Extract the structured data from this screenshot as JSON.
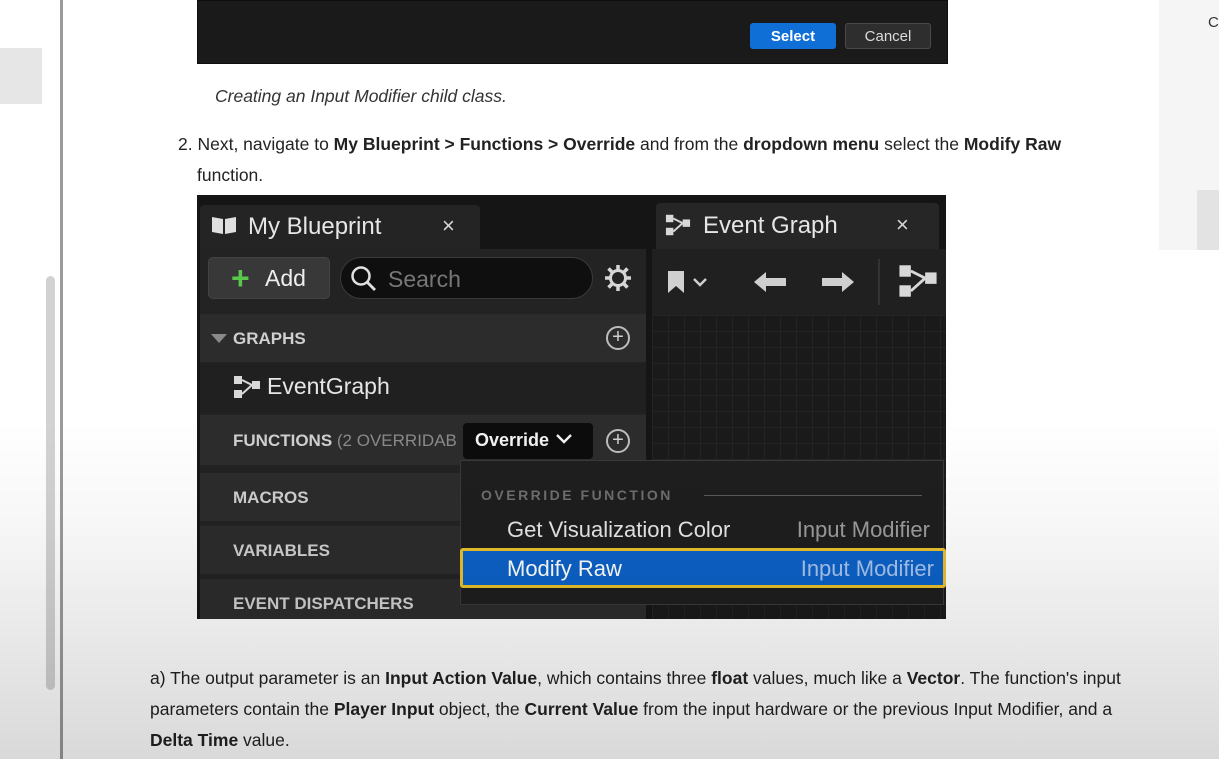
{
  "dialog": {
    "select_label": "Select",
    "cancel_label": "Cancel"
  },
  "caption": "Creating an Input Modifier child class.",
  "step2": {
    "number": "2.",
    "t1": " Next, navigate to ",
    "b1": "My Blueprint > Functions > Override",
    "t2": " and from the ",
    "b2": "dropdown menu",
    "t3": " select the ",
    "b3": "Modify Raw",
    "t4": " function."
  },
  "editor": {
    "my_blueprint_tab": "My Blueprint",
    "event_graph_tab": "Event Graph",
    "close_glyph": "×",
    "add_label": "Add",
    "add_glyph": "+",
    "search_placeholder": "Search",
    "graphs_label": "GRAPHS",
    "eventgraph_item": "EventGraph",
    "functions_label": "FUNCTIONS",
    "functions_note": " (2 OVERRIDAB",
    "override_label": "Override",
    "macros_label": "MACROS",
    "variables_label": "VARIABLES",
    "dispatchers_label": "EVENT DISPATCHERS",
    "dropdown": {
      "section": "OVERRIDE FUNCTION",
      "items": [
        {
          "name": "Get Visualization Color",
          "category": "Input Modifier"
        },
        {
          "name": "Modify Raw",
          "category": "Input Modifier"
        }
      ]
    },
    "colors": {
      "selection": "#0c61c7",
      "highlight_border": "#e8c12c",
      "add_plus": "#59c84a"
    }
  },
  "para": {
    "p1": "a) The output parameter is an ",
    "b1": "Input Action Value",
    "p2": ", which contains three ",
    "b2": "float",
    "p3": " values, much like a ",
    "b3": "Vector",
    "p4": ". The function's input parameters contain the ",
    "b4": "Player Input",
    "p5": " object, the ",
    "b5": "Current Value",
    "p6": " from the input hardware or the previous Input Modifier, and a ",
    "b6": "Delta Time",
    "p7": " value."
  },
  "right_panel": {
    "char": "C"
  }
}
